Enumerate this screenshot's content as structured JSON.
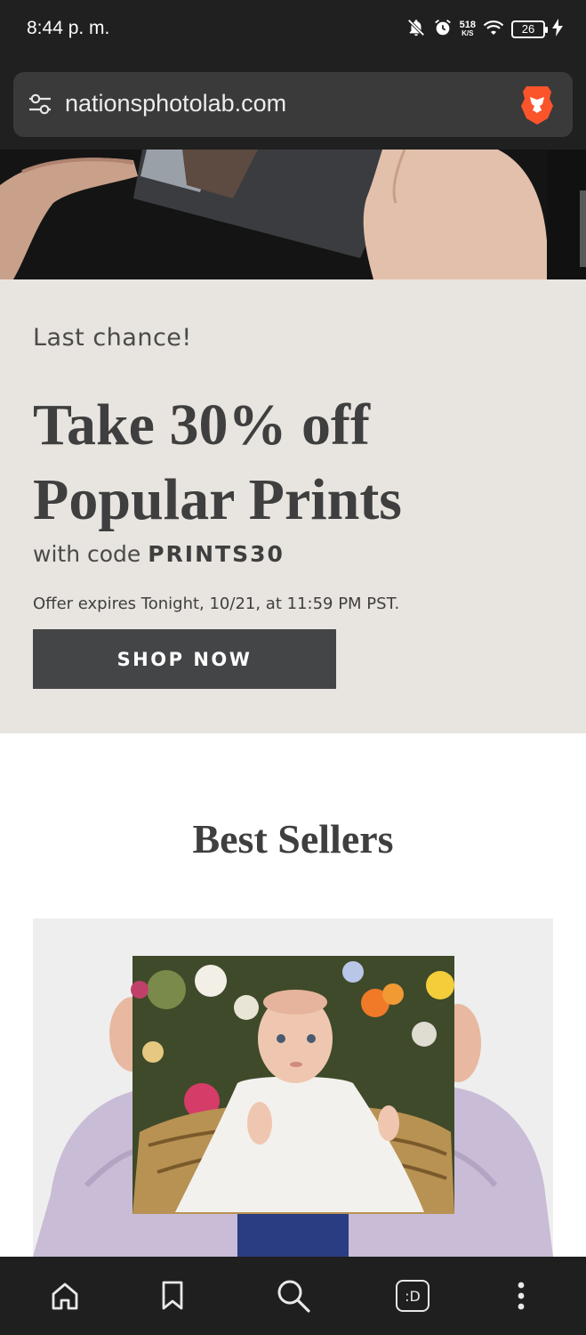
{
  "status_bar": {
    "time": "8:44 p. m.",
    "net_speed_value": "518",
    "net_speed_unit": "K/S",
    "battery": "26",
    "icons": [
      "notifications-off-icon",
      "alarm-icon",
      "wifi-icon",
      "battery-icon",
      "charging-bolt-icon"
    ]
  },
  "browser": {
    "url": "nationsphotolab.com",
    "site_settings_icon": "tune-icon",
    "brand_icon": "brave-lion-icon",
    "accent_color": "#fb542b"
  },
  "promo": {
    "eyebrow": "Last chance!",
    "headline_line1": "Take 30% off",
    "headline_line2": "Popular Prints",
    "code_prefix": "with code ",
    "code": "PRINTS30",
    "expiry": "Offer expires Tonight, 10/21, at 11:59 PM PST.",
    "cta_label": "SHOP NOW",
    "background_color": "#e8e4df",
    "cta_color": "#444547"
  },
  "best_sellers": {
    "title": "Best Sellers"
  },
  "bottom_nav": {
    "items": [
      "home-icon",
      "bookmark-icon",
      "search-icon",
      "tab-switcher-icon",
      "more-options-icon"
    ],
    "tab_switcher_label": ":D"
  }
}
